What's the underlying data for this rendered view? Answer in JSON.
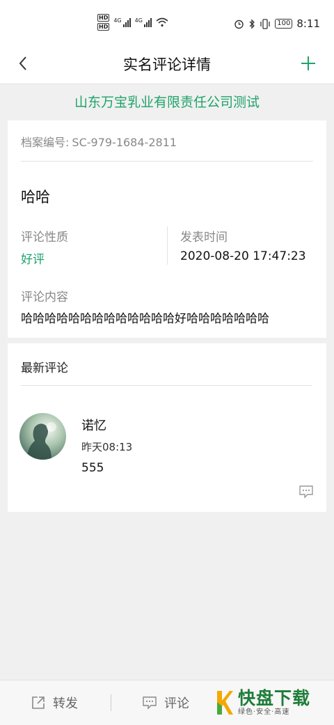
{
  "statusbar": {
    "sim1": "HD",
    "sim2": "HD",
    "net1": "4G",
    "net2": "4G",
    "battery": "100",
    "time": "8:11"
  },
  "nav": {
    "title": "实名评论详情"
  },
  "company": "山东万宝乳业有限责任公司测试",
  "detail": {
    "archive_label": "档案编号:",
    "archive_number": "SC-979-1684-2811",
    "title": "哈哈",
    "nature_label": "评论性质",
    "nature_value": "好评",
    "time_label": "发表时间",
    "time_value": "2020-08-20 17:47:23",
    "content_label": "评论内容",
    "content_value": "哈哈哈哈哈哈哈哈哈哈哈哈哈好哈哈哈哈哈哈哈"
  },
  "comments": {
    "header": "最新评论",
    "items": [
      {
        "name": "诺忆",
        "time": "昨天08:13",
        "text": "555"
      }
    ]
  },
  "bottombar": {
    "forward_label": "转发",
    "comment_label": "评论"
  },
  "watermark": {
    "logo_letter": "K",
    "main": "快盘下载",
    "sub": "绿色·安全·高速"
  },
  "colors": {
    "accent": "#1ea36a",
    "background": "#f0f0f0"
  }
}
